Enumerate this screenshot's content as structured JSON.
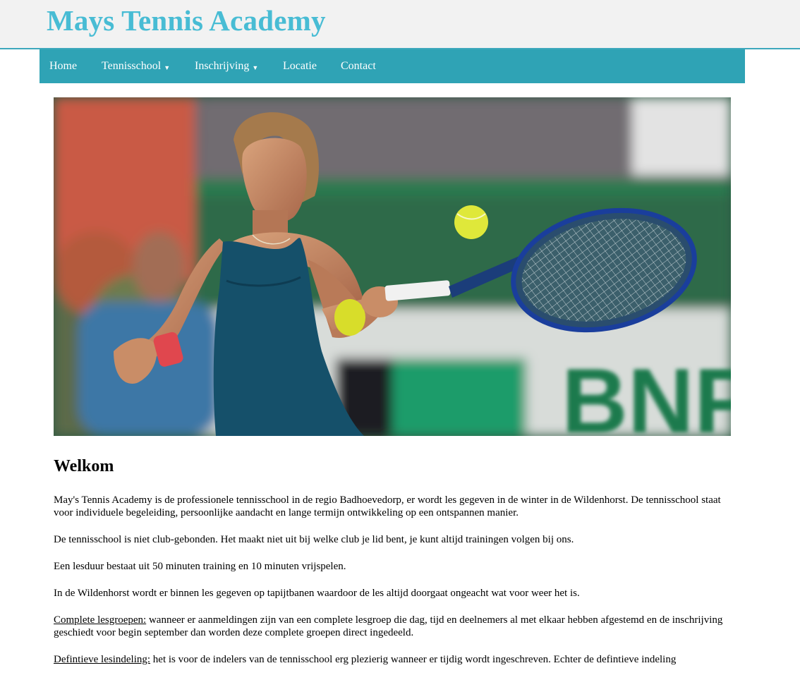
{
  "site": {
    "title": "Mays Tennis Academy"
  },
  "nav": {
    "items": [
      {
        "label": "Home",
        "dropdown": false
      },
      {
        "label": "Tennisschool",
        "dropdown": true
      },
      {
        "label": "Inschrijving",
        "dropdown": true
      },
      {
        "label": "Locatie",
        "dropdown": false
      },
      {
        "label": "Contact",
        "dropdown": false
      }
    ],
    "dropdown_glyph": "▼"
  },
  "hero": {
    "banner_text": "BNP"
  },
  "main": {
    "heading": "Welkom",
    "p1": "May's Tennis Academy is de professionele tennisschool in de regio Badhoevedorp, er wordt les gegeven in de winter in de Wildenhorst. De tennisschool staat voor individuele begeleiding, persoonlijke aandacht en lange termijn ontwikkeling op een ontspannen manier.",
    "p2": "De tennisschool is niet club-gebonden. Het maakt niet uit bij welke club je lid bent, je kunt altijd trainingen volgen bij ons.",
    "p3": "Een lesduur bestaat uit 50 minuten training en 10 minuten vrijspelen.",
    "p4": "In de Wildenhorst wordt er binnen les gegeven op tapijtbanen waardoor de les altijd doorgaat ongeacht wat voor weer het is.",
    "p5_label": "Complete lesgroepen:",
    "p5_text": " wanneer er aanmeldingen zijn van een complete lesgroep die dag, tijd en deelnemers al met elkaar hebben afgestemd en de inschrijving geschiedt voor begin september dan worden deze complete groepen direct ingedeeld.",
    "p6_label": "Defintieve lesindeling:",
    "p6_text": " het is voor de indelers van de tennisschool erg plezierig wanneer er tijdig wordt ingeschreven. Echter de defintieve indeling"
  },
  "colors": {
    "title": "#48bcd4",
    "nav_bg": "#2fa3b5",
    "header_bg": "#f2f2f2",
    "header_border": "#3ea8bc"
  }
}
